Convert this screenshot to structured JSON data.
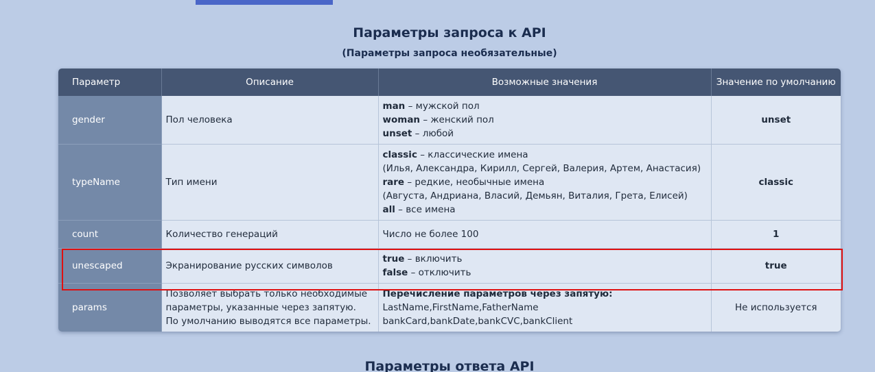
{
  "section": {
    "title": "Параметры запроса к API",
    "subtitle": "(Параметры запроса необязательные)",
    "next_title": "Параметры ответа API"
  },
  "top_fragment": {
    "text": "                     "
  },
  "table": {
    "headers": {
      "param": "Параметр",
      "description": "Описание",
      "values": "Возможные значения",
      "default": "Значение по умолчанию"
    },
    "rows": [
      {
        "name": "gender",
        "description": "Пол человека",
        "values": [
          {
            "key": "man",
            "text": " – мужской пол"
          },
          {
            "key": "woman",
            "text": " – женский пол"
          },
          {
            "key": "unset",
            "text": " – любой"
          }
        ],
        "default": "unset"
      },
      {
        "name": "typeName",
        "description": "Тип имени",
        "values": [
          {
            "key": "classic",
            "text": " – классические имена"
          },
          {
            "key": "",
            "text": "(Илья, Александра, Кирилл, Сергей, Валерия, Артем, Анастасия)"
          },
          {
            "key": "rare",
            "text": " – редкие, необычные имена"
          },
          {
            "key": "",
            "text": "(Августа, Андриана, Власий, Демьян, Виталия, Грета, Елисей)"
          },
          {
            "key": "all",
            "text": " – все имена"
          }
        ],
        "default": "classic"
      },
      {
        "name": "count",
        "description": "Количество генераций",
        "values": [
          {
            "key": "",
            "text": "Число не более 100"
          }
        ],
        "default": "1"
      },
      {
        "name": "unescaped",
        "description": "Экранирование русских символов",
        "values": [
          {
            "key": "true",
            "text": " – включить"
          },
          {
            "key": "false",
            "text": " – отключить"
          }
        ],
        "default": "true"
      },
      {
        "name": "params",
        "description_lines": [
          "Позволяет выбрать только необходимые",
          "параметры, указанные через запятую.",
          "По умолчанию выводятся все параметры."
        ],
        "values": [
          {
            "key": "Перечисление параметров через запятую:",
            "text": ""
          },
          {
            "key": "",
            "text": "LastName,FirstName,FatherName"
          },
          {
            "key": "",
            "text": "bankCard,bankDate,bankCVC,bankClient"
          }
        ],
        "default": "Не используется"
      }
    ]
  },
  "colors": {
    "page_bg": "#bccce6",
    "header_bg": "#455673",
    "param_cell_bg": "#7489a8",
    "cell_bg": "#dfe7f3",
    "highlight": "#e01010",
    "tab_accent": "#4a66c8"
  }
}
